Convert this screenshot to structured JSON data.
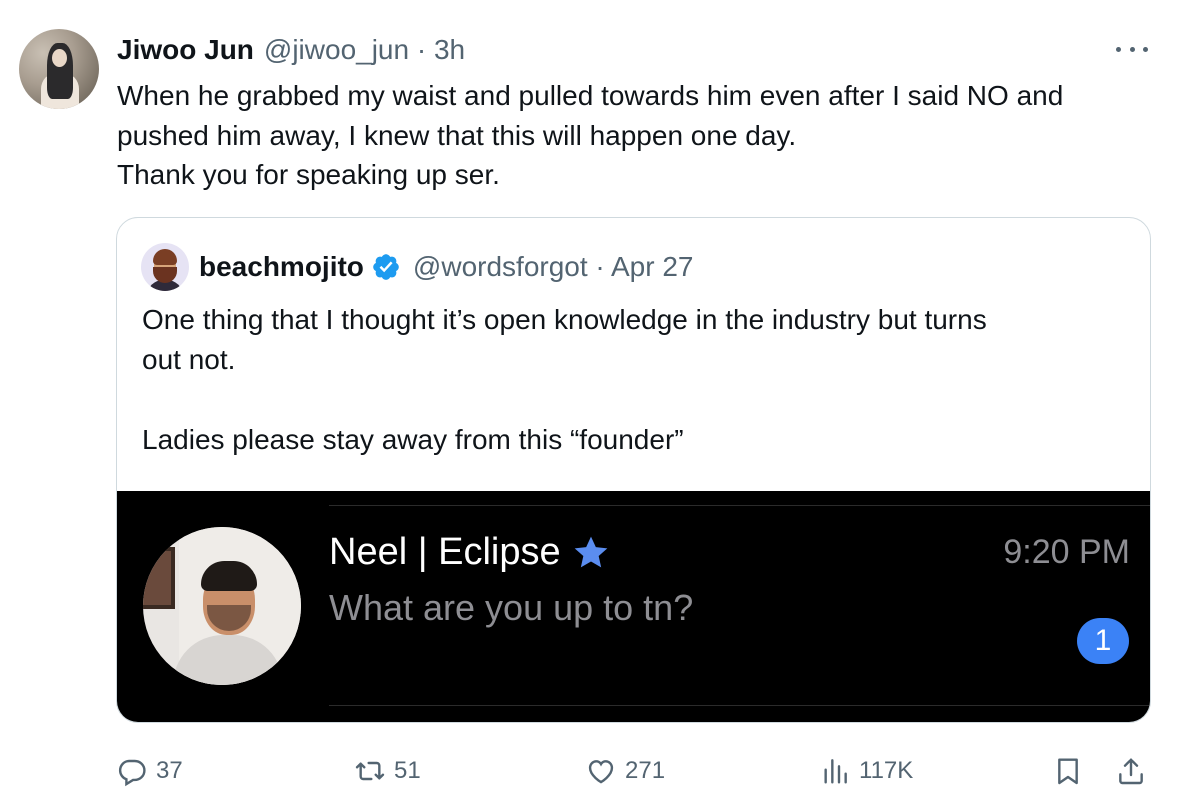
{
  "author": {
    "name": "Jiwoo Jun",
    "handle": "@jiwoo_jun · 3h"
  },
  "tweet": {
    "lines": [
      "When he grabbed my waist and pulled towards him even after I said NO and",
      "pushed him away, I knew that this will happen one day.",
      "Thank you for speaking up ser."
    ]
  },
  "quoted": {
    "name": "beachmojito",
    "verified_icon": "verified-badge-icon",
    "handle": "@wordsforgot · Apr 27",
    "lines": [
      "One thing that I  thought it’s open knowledge in the industry but turns",
      "out not.",
      "Ladies please stay away from this “founder”"
    ],
    "media": {
      "contact_name": "Neel | Eclipse",
      "time": "9:20 PM",
      "message": "What are you up to tn?",
      "unread_count": "1",
      "star_color": "#5b8def",
      "badge_color": "#3b82f6"
    }
  },
  "actions": {
    "replies": "37",
    "retweets": "51",
    "likes": "271",
    "views": "117K"
  },
  "colors": {
    "text": "#0f1419",
    "muted": "#536471",
    "border": "#cfd9de",
    "verified": "#1d9bf0"
  }
}
